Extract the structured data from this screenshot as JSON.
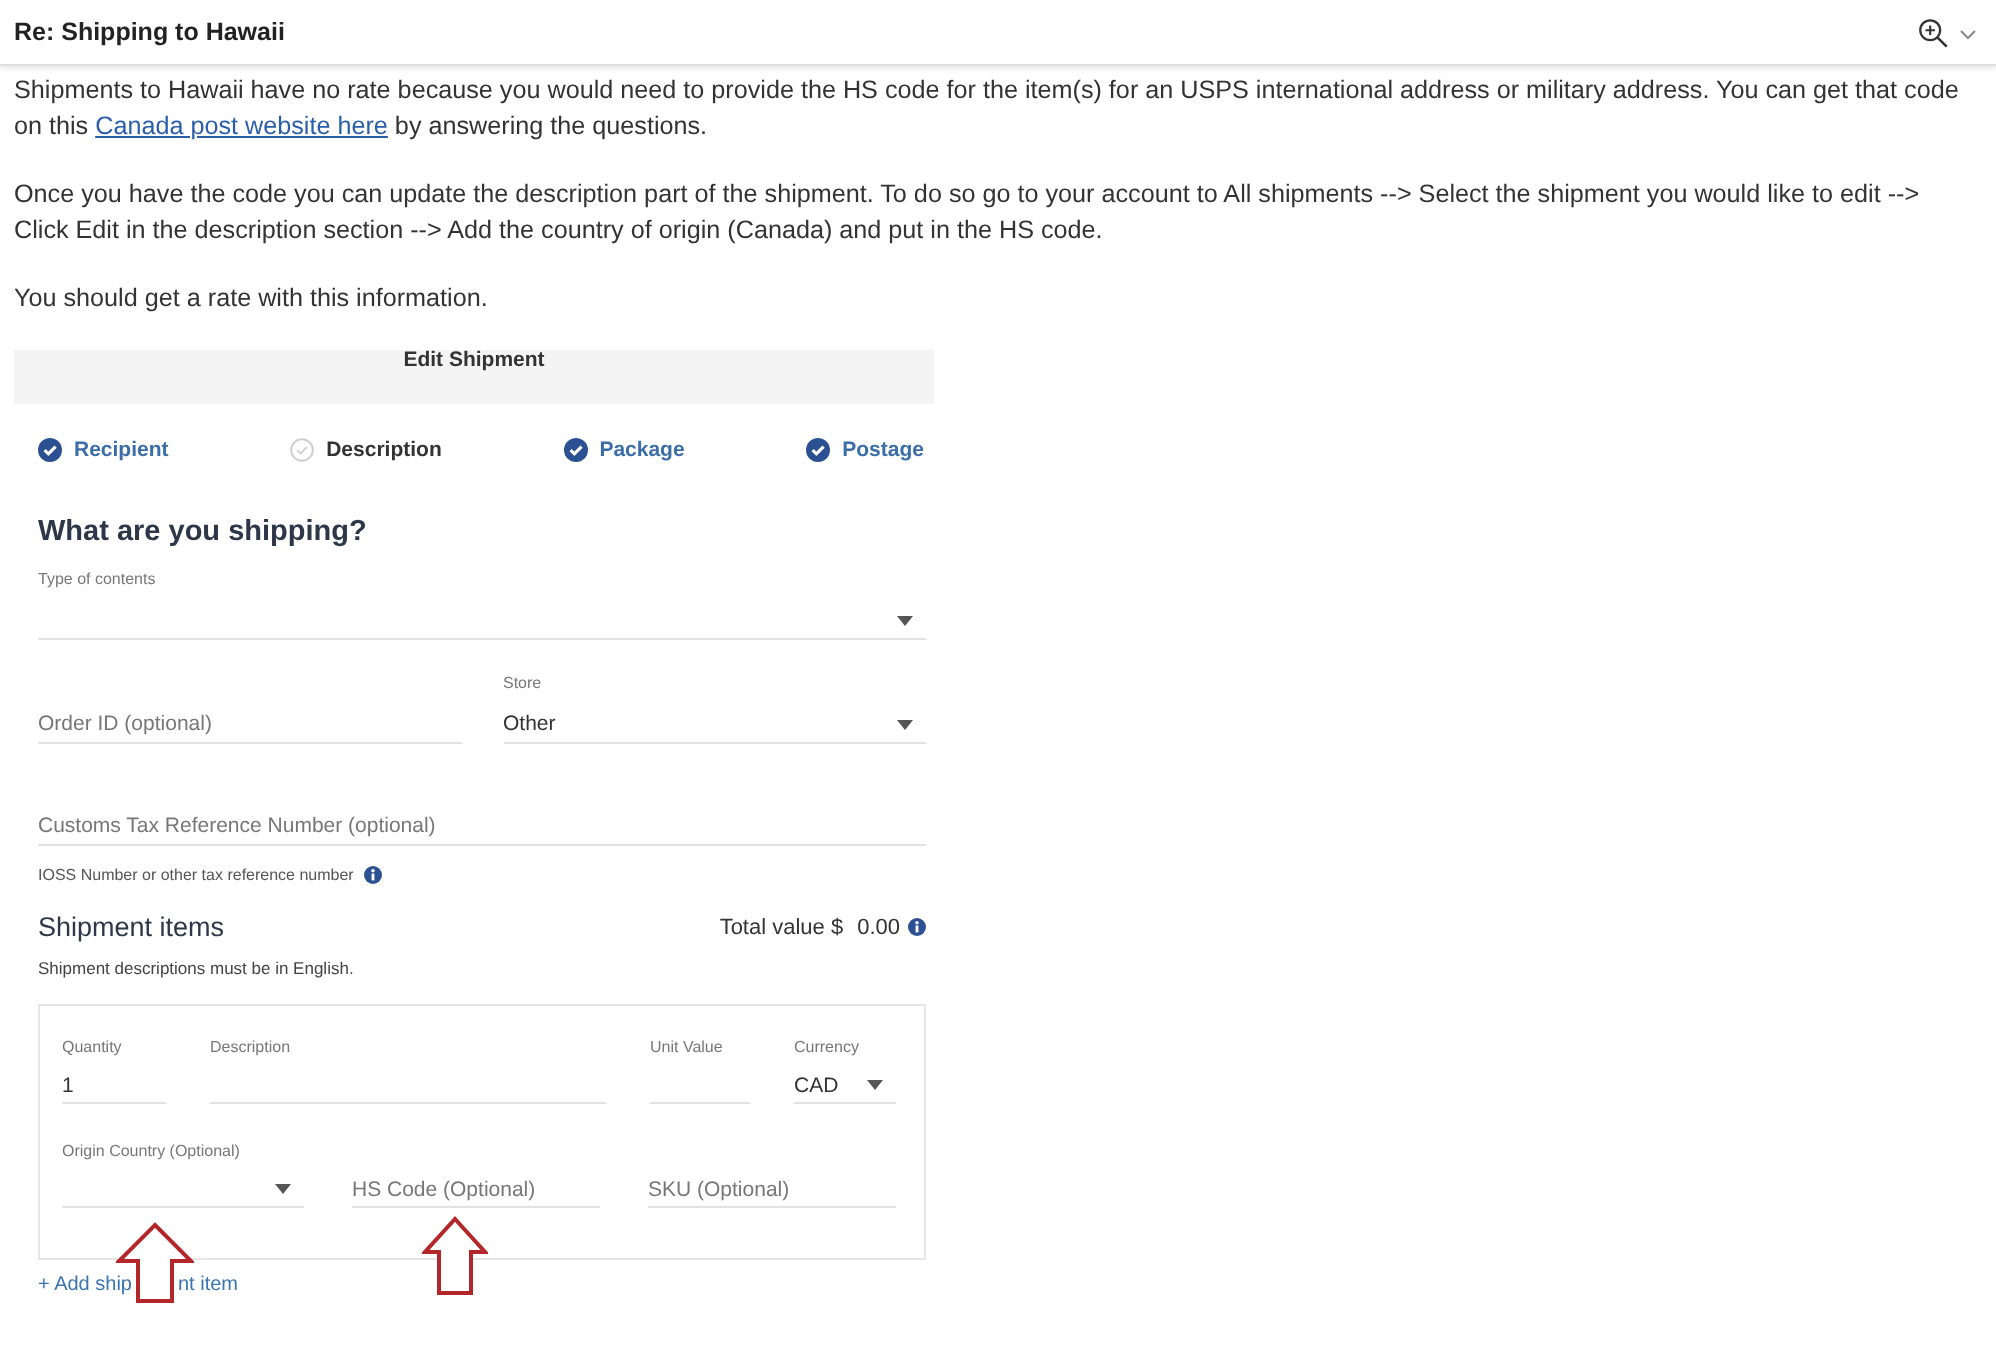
{
  "header": {
    "title": "Re: Shipping to Hawaii"
  },
  "message": {
    "paragraphs": [
      {
        "before": "Shipments to Hawaii have no rate because you would need to provide the HS code for the item(s) for an USPS international address or military address. You can get that code on this ",
        "link": "Canada post website here",
        "after": " by answering the questions."
      },
      {
        "before": "Once you have the code you can update the description part of the shipment. To do so go to your account to All shipments --> Select the shipment you would like to edit --> Click Edit in the description section --> Add the country of origin (Canada) and put in the HS code."
      },
      {
        "before": "You should get a rate with this information."
      }
    ]
  },
  "edit_shipment": {
    "title": "Edit Shipment",
    "steps": [
      {
        "label": "Recipient",
        "completed": true
      },
      {
        "label": "Description",
        "completed": false
      },
      {
        "label": "Package",
        "completed": true
      },
      {
        "label": "Postage",
        "completed": true
      }
    ],
    "heading": "What are you shipping?",
    "form_rows": [
      {
        "fields": [
          {
            "kind": "select",
            "label": "Type of contents"
          }
        ]
      },
      {
        "fields": [
          {
            "kind": "text",
            "placeholder": "Order ID (optional)"
          },
          {
            "kind": "select",
            "label": "Store",
            "value": "Other"
          }
        ]
      },
      {
        "fields": [
          {
            "kind": "text",
            "placeholder": "Customs Tax Reference Number (optional)",
            "helper": "IOSS Number or other tax reference number"
          }
        ]
      }
    ],
    "shipment_items": {
      "title": "Shipment items",
      "total_label": "Total value $",
      "total_value": "0.00",
      "note": "Shipment descriptions must be in English."
    },
    "item_rows": [
      {
        "fields": [
          {
            "kind": "text",
            "label": "Quantity",
            "value": "1"
          },
          {
            "kind": "text",
            "label": "Description"
          },
          {
            "kind": "text",
            "label": "Unit Value"
          },
          {
            "kind": "select",
            "label": "Currency",
            "value": "CAD"
          }
        ]
      },
      {
        "fields": [
          {
            "kind": "select",
            "label": "Origin Country (Optional)"
          },
          {
            "kind": "text",
            "placeholder": "HS Code (Optional)"
          },
          {
            "kind": "text",
            "placeholder": "SKU (Optional)"
          }
        ]
      }
    ],
    "add_item_link": {
      "before": "+ Add ship",
      "after": "nt item"
    }
  }
}
